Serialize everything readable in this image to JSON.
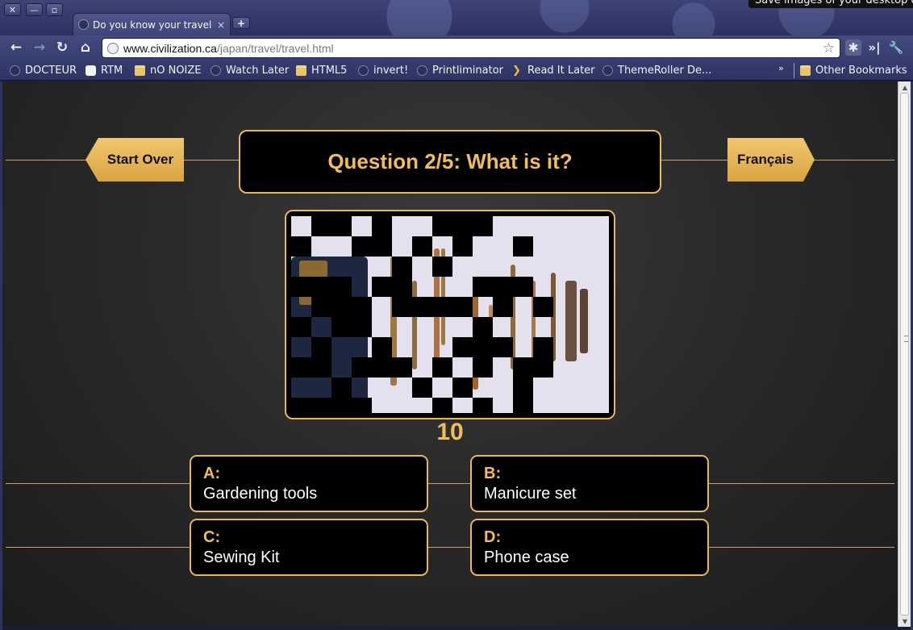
{
  "tooltip": "Save images of your desktop c",
  "browser": {
    "tab_title": "Do you know your travel g",
    "tab_close": "×",
    "new_tab": "+",
    "url_host": "www.civilization.ca",
    "url_path": "/japan/travel/travel.html",
    "bookmarks": [
      {
        "label": "DOCTEUR",
        "icon": "globe-icon"
      },
      {
        "label": "RTM",
        "icon": "rtm-icon"
      },
      {
        "label": "nO NOIZE",
        "icon": "folder-icon"
      },
      {
        "label": "Watch Later",
        "icon": "globe-icon"
      },
      {
        "label": "HTML5",
        "icon": "folder-icon"
      },
      {
        "label": "invert!",
        "icon": "globe-icon"
      },
      {
        "label": "Printliminator",
        "icon": "globe-icon"
      },
      {
        "label": "Read It Later",
        "icon": "chevron-icon"
      },
      {
        "label": "ThemeRoller De...",
        "icon": "globe-icon"
      }
    ],
    "bookmarks_overflow": "»",
    "other_bookmarks": "Other Bookmarks"
  },
  "quiz": {
    "start_over": "Start Over",
    "language": "Français",
    "question": "Question 2/5: What is it?",
    "timer": "10",
    "answers": [
      {
        "letter": "A:",
        "text": "Gardening tools"
      },
      {
        "letter": "B:",
        "text": "Manicure set"
      },
      {
        "letter": "C:",
        "text": "Sewing Kit"
      },
      {
        "letter": "D:",
        "text": "Phone case"
      }
    ]
  },
  "colors": {
    "accent": "#f2bd58",
    "border": "#e8b75a",
    "background": "#2a2a2a"
  }
}
